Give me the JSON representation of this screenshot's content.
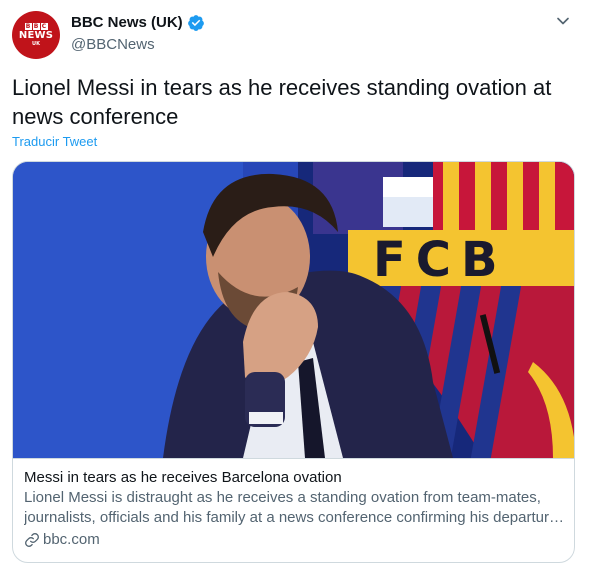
{
  "author": {
    "display_name": "BBC News (UK)",
    "handle": "@BBCNews",
    "avatar": {
      "brand_letters": [
        "B",
        "B",
        "C"
      ],
      "word": "NEWS",
      "region": "UK",
      "color": "#c0131a"
    },
    "verified": true
  },
  "tweet": {
    "text": "Lionel Messi in tears as he receives standing ovation at news conference",
    "translate_label": "Traducir Tweet"
  },
  "card": {
    "image_description_text": "FCB",
    "title": "Messi in tears as he receives Barcelona ovation",
    "description": "Lionel Messi is distraught as he receives a standing ovation from team-mates, journalists, officials and his family at a news conference confirming his departure from Barcelona",
    "domain": "bbc.com"
  },
  "colors": {
    "accent": "#1d9bf0",
    "text_primary": "#0f1419",
    "text_secondary": "#536471",
    "border": "#cfd9de"
  },
  "icons": {
    "verified": "verified-badge-icon",
    "more": "more-options-icon",
    "link": "link-icon"
  }
}
